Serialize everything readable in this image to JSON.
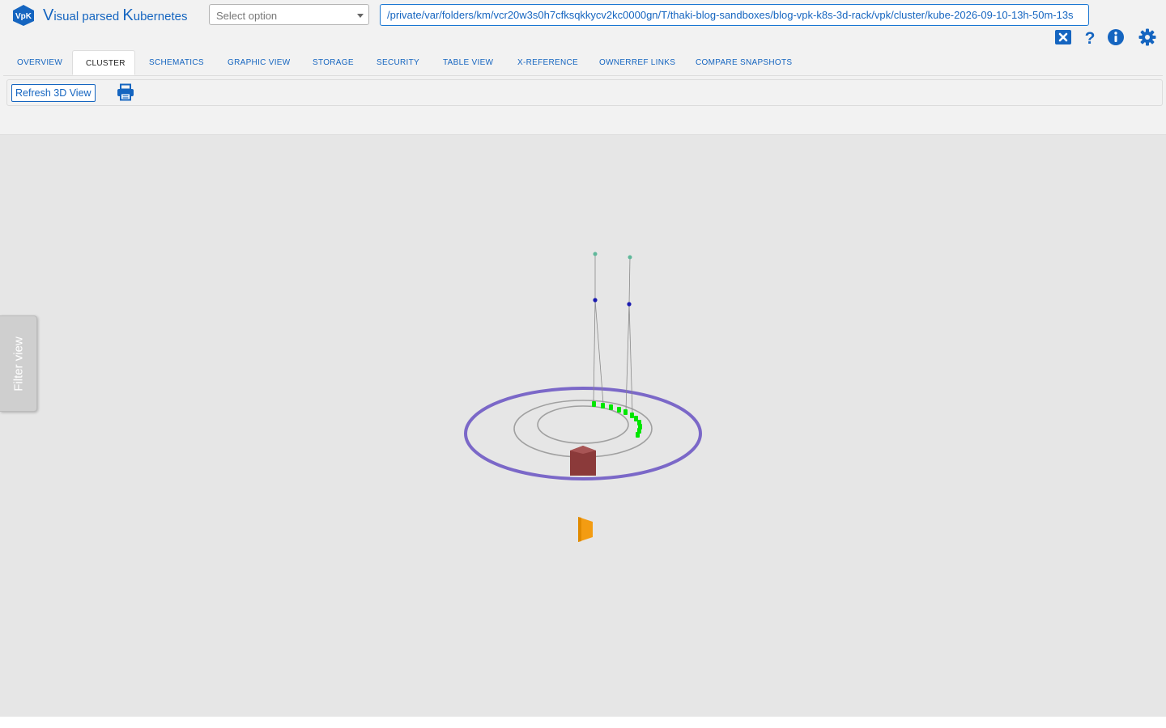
{
  "header": {
    "logo_text": "VpK",
    "title_parts": [
      "V",
      "isual parsed ",
      "K",
      "ubernetes"
    ],
    "select_placeholder": "Select option",
    "path": "/private/var/folders/km/vcr20w3s0h7cfksqkkycv2kc0000gn/T/thaki-blog-sandboxes/blog-vpk-k8s-3d-rack/vpk/cluster/kube-2026-09-10-13h-50m-13s",
    "icons": [
      "close-icon",
      "help-icon",
      "info-icon",
      "settings-icon"
    ]
  },
  "tabs": [
    {
      "label": "OVERVIEW",
      "active": false
    },
    {
      "label": "CLUSTER",
      "active": true
    },
    {
      "label": "SCHEMATICS",
      "active": false
    },
    {
      "label": "GRAPHIC VIEW",
      "active": false
    },
    {
      "label": "STORAGE",
      "active": false
    },
    {
      "label": "SECURITY",
      "active": false
    },
    {
      "label": "TABLE VIEW",
      "active": false
    },
    {
      "label": "X-REFERENCE",
      "active": false
    },
    {
      "label": "OWNERREF LINKS",
      "active": false
    },
    {
      "label": "COMPARE SNAPSHOTS",
      "active": false
    }
  ],
  "toolbar": {
    "refresh_label": "Refresh 3D View",
    "print_icon": "print-icon"
  },
  "viewport": {
    "filter_label": "Filter view"
  },
  "colors": {
    "accent": "#1565c0",
    "outer_ring": "#7b68c8",
    "inner_ring": "#9e9e9e",
    "pod": "#00e600",
    "node_box": "#8b3a3a",
    "control_marker": "#f39c12",
    "endpoint_top": "#5fb89a",
    "endpoint_mid": "#1a1ab0"
  }
}
